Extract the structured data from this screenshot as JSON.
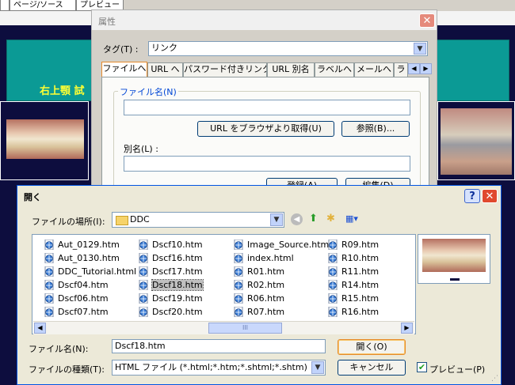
{
  "editor": {
    "tabs": [
      "",
      "ページ/ソース",
      "プレビュー"
    ],
    "heading": "右上顎 試"
  },
  "properties_dialog": {
    "title": "属性",
    "tag_label": "タグ(T) :",
    "tag_value": "リンク",
    "tabs": [
      "ファイルへ",
      "URL へ",
      "パスワード付きリンク",
      "URL 別名",
      "ラベルへ",
      "メールへ",
      "ラ"
    ],
    "filename_group": "ファイル名(N)",
    "filename_value": "",
    "get_url_button": "URL をブラウザより取得(U)",
    "browse_button": "参照(B)...",
    "alias_label": "別名(L) :",
    "alias_value": "",
    "register_button": "登録(A)",
    "edit_button": "編集(D)"
  },
  "open_dialog": {
    "title": "開く",
    "location_label": "ファイルの場所(I):",
    "location_value": "DDC",
    "files": [
      [
        "Aut_0129.htm",
        "Aut_0130.htm",
        "DDC_Tutorial.html",
        "Dscf04.htm",
        "Dscf06.htm",
        "Dscf07.htm"
      ],
      [
        "Dscf10.htm",
        "Dscf16.htm",
        "Dscf17.htm",
        "Dscf18.htm",
        "Dscf19.htm",
        "Dscf20.htm"
      ],
      [
        "Image_Source.htm",
        "index.html",
        "R01.htm",
        "R02.htm",
        "R06.htm",
        "R07.htm"
      ],
      [
        "R09.htm",
        "R10.htm",
        "R11.htm",
        "R14.htm",
        "R15.htm",
        "R16.htm"
      ]
    ],
    "selected_file": "Dscf18.htm",
    "scroll_grip": "III",
    "filename_label": "ファイル名(N):",
    "filename_value": "Dscf18.htm",
    "filetype_label": "ファイルの種類(T):",
    "filetype_value": "HTML ファイル (*.html;*.htm;*.shtml;*.shtm)",
    "open_button": "開く(O)",
    "cancel_button": "キャンセル",
    "preview_checkbox": "プレビュー(P)",
    "preview_checked": true
  },
  "colors": {
    "teal": "#0b9a95",
    "heading": "#ffff33",
    "close_red": "#e0492d",
    "xp_blue": "#0054e3"
  }
}
